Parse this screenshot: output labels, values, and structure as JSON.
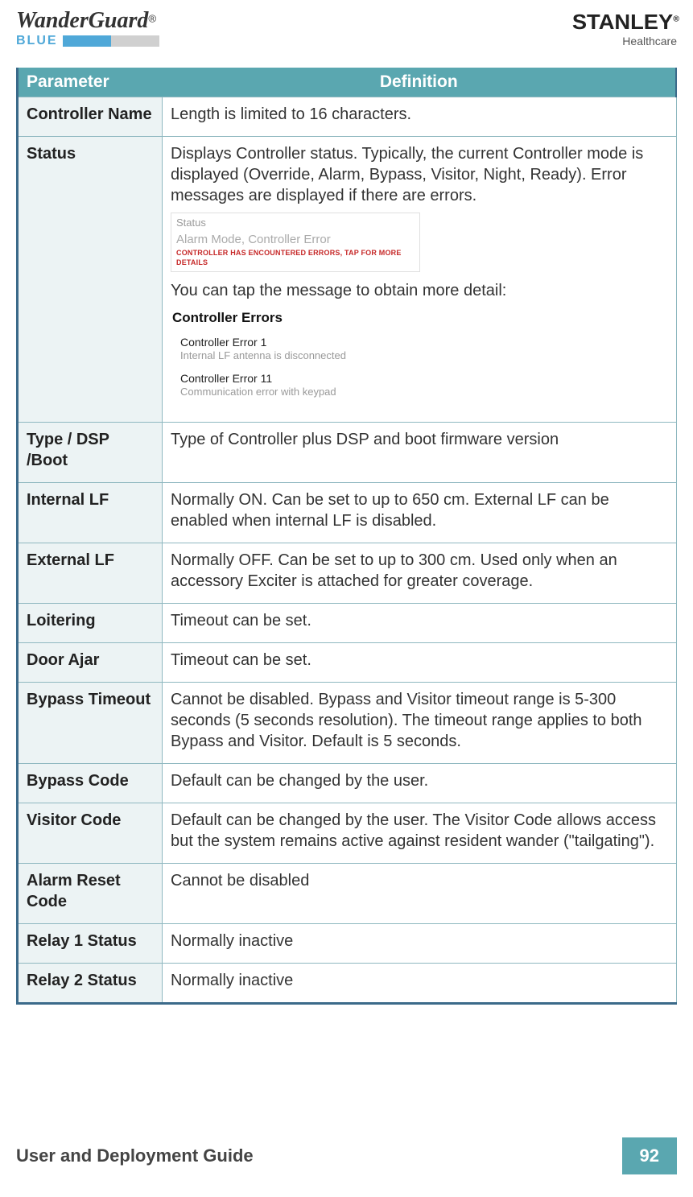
{
  "header": {
    "logo_main": "WanderGuard",
    "logo_r": "®",
    "logo_sub": "BLUE",
    "brand": "STANLEY",
    "brand_tm": "®",
    "brand_sub": "Healthcare"
  },
  "table": {
    "headers": {
      "param": "Parameter",
      "def": "Definition"
    },
    "rows": [
      {
        "param": "Controller Name",
        "def": "Length is limited to 16 characters."
      },
      {
        "param": "Status",
        "def_pre": "Displays Controller status. Typically, the current Controller mode is displayed (Override, Alarm, Bypass, Visitor, Night, Ready). Error messages are displayed if there are errors.",
        "widget1": {
          "label": "Status",
          "mode": "Alarm Mode, Controller Error",
          "err": "CONTROLLER HAS ENCOUNTERED ERRORS, TAP FOR MORE DETAILS"
        },
        "def_mid": "You can tap the message to obtain more detail:",
        "widget2": {
          "title": "Controller Errors",
          "items": [
            {
              "t": "Controller Error 1",
              "d": "Internal LF antenna is disconnected"
            },
            {
              "t": "Controller Error 11",
              "d": "Communication error with keypad"
            }
          ]
        }
      },
      {
        "param": "Type / DSP /Boot",
        "def": "Type of Controller plus DSP and boot firmware version"
      },
      {
        "param": "Internal LF",
        "def": "Normally ON. Can be set to up to 650 cm. External LF can be enabled when internal LF is disabled."
      },
      {
        "param": "External LF",
        "def": "Normally OFF. Can be set to up to 300 cm. Used only when an accessory Exciter is attached for greater coverage."
      },
      {
        "param": "Loitering",
        "def": "Timeout can be set."
      },
      {
        "param": "Door Ajar",
        "def": "Timeout can be set."
      },
      {
        "param": "Bypass Timeout",
        "def": "Cannot be disabled. Bypass and Visitor timeout range is 5-300 seconds (5 seconds resolution). The timeout range applies to both Bypass and Visitor. Default is 5 seconds."
      },
      {
        "param": "Bypass Code",
        "def": "Default can be changed by the user."
      },
      {
        "param": "Visitor Code",
        "def": "Default can be changed by the user. The Visitor Code allows access but the system remains active against resident wander (\"tailgating\")."
      },
      {
        "param": "Alarm Reset Code",
        "def": "Cannot be disabled"
      },
      {
        "param": "Relay 1 Status",
        "def": "Normally inactive"
      },
      {
        "param": "Relay 2 Status",
        "def": "Normally inactive"
      }
    ]
  },
  "footer": {
    "title": "User and Deployment Guide",
    "page": "92"
  }
}
